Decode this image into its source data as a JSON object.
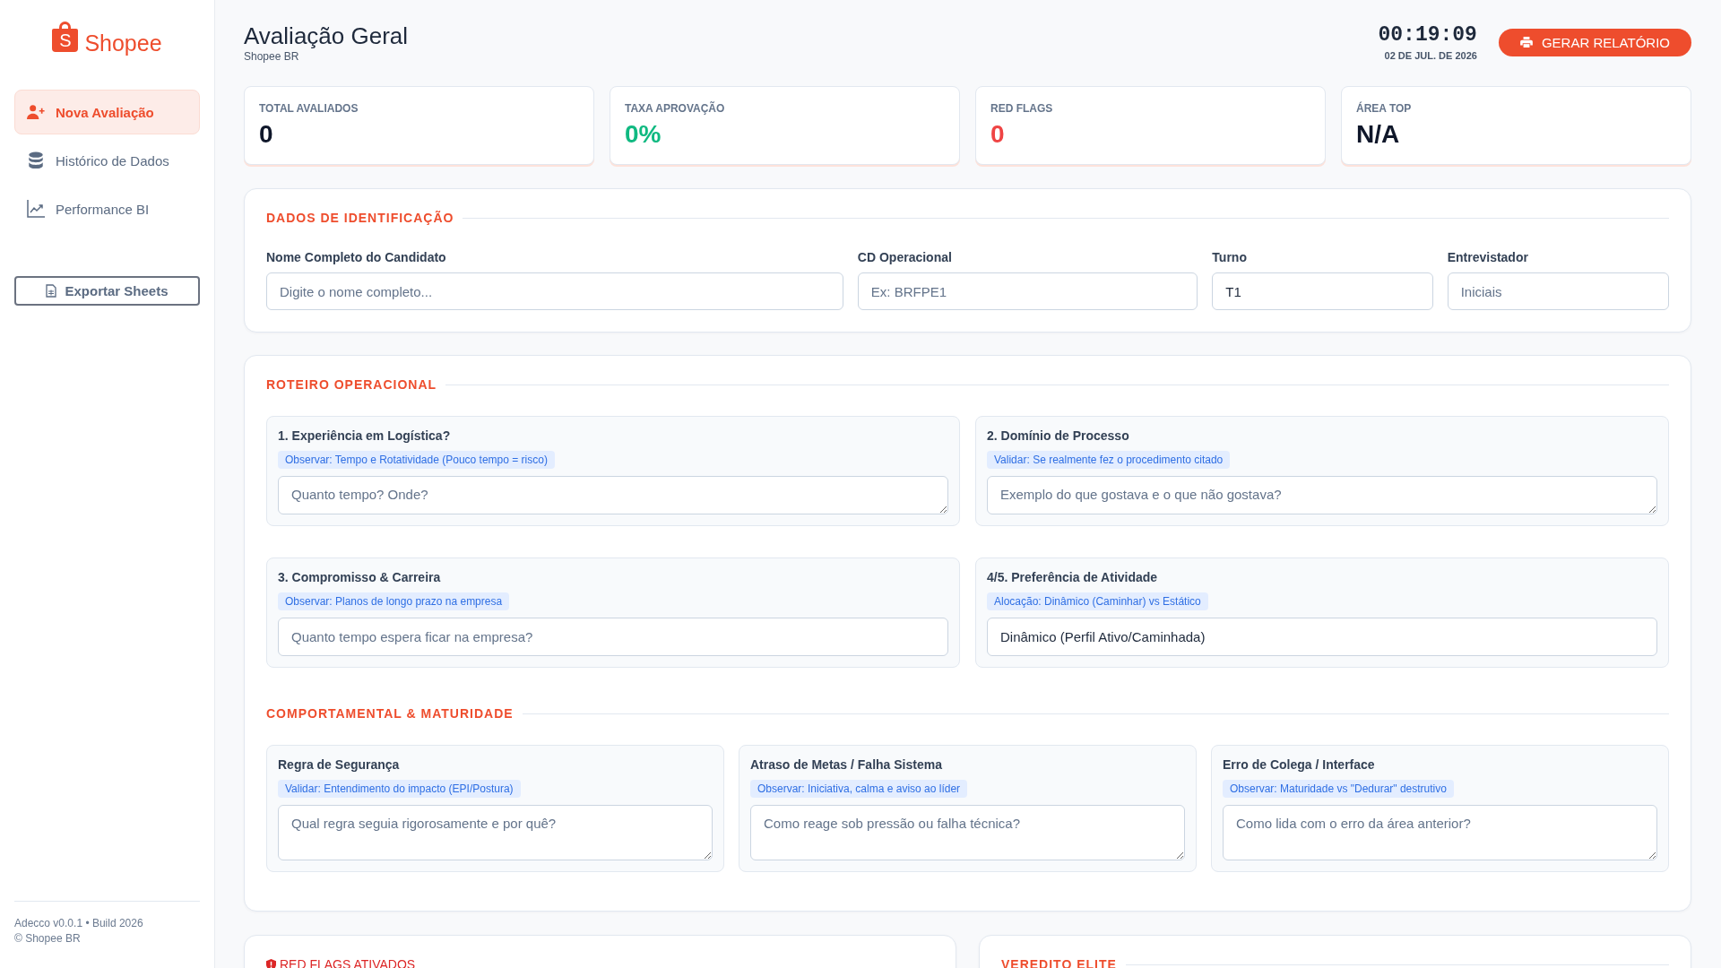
{
  "sidebar": {
    "logo": {
      "mark": "S",
      "name": "Shopee"
    },
    "nav_items": [
      {
        "label": "Nova Avaliação",
        "selected": true
      },
      {
        "label": "Histórico de Dados",
        "selected": false
      },
      {
        "label": "Performance BI",
        "selected": false
      }
    ],
    "export_button": "Exportar Sheets",
    "footer": [
      "Adecco v0.0.1 • Build 2026",
      "© Shopee BR"
    ]
  },
  "header": {
    "title": "Avaliação Geral",
    "subtitle": "Shopee BR",
    "clock": "00:19:09",
    "date": "02 DE JUL. DE 2026",
    "report_button": "GERAR RELATÓRIO"
  },
  "stats": [
    {
      "label": "TOTAL AVALIADOS",
      "value": "0",
      "color": "#0f172a"
    },
    {
      "label": "TAXA APROVAÇÃO",
      "value": "0%",
      "color": "#10b981"
    },
    {
      "label": "RED FLAGS",
      "value": "0",
      "color": "#ef4444"
    },
    {
      "label": "ÁREA TOP",
      "value": "N/A",
      "color": "#0f172a"
    }
  ],
  "identification": {
    "title": "DADOS DE IDENTIFICAÇÃO",
    "fields": [
      {
        "label": "Nome Completo do Candidato",
        "placeholder": "Digite o nome completo..."
      },
      {
        "label": "CD Operacional",
        "placeholder": "Ex: BRFPE1"
      },
      {
        "label": "Turno",
        "value": "T1"
      },
      {
        "label": "Entrevistador",
        "placeholder": "Iniciais"
      }
    ]
  },
  "script": {
    "sections": [
      {
        "title": "ROTEIRO OPERACIONAL",
        "questions": [
          {
            "title": "1. Experiência em Logística?",
            "hint": "Observar: Tempo e Rotatividade (Pouco tempo = risco)",
            "kind": "textarea",
            "placeholder": "Quanto tempo? Onde?"
          },
          {
            "title": "2. Domínio de Processo",
            "hint": "Validar: Se realmente fez o procedimento citado",
            "kind": "textarea",
            "placeholder": "Exemplo do que gostava e o que não gostava?"
          },
          {
            "title": "3. Compromisso & Carreira",
            "hint": "Observar: Planos de longo prazo na empresa",
            "kind": "input",
            "placeholder": "Quanto tempo espera ficar na empresa?"
          },
          {
            "title": "4/5. Preferência de Atividade",
            "hint": "Alocação: Dinâmico (Caminhar) vs Estático",
            "kind": "select",
            "value": "Dinâmico (Perfil Ativo/Caminhada)"
          }
        ]
      },
      {
        "title": "COMPORTAMENTAL & MATURIDADE",
        "questions": [
          {
            "title": "Regra de Segurança",
            "hint": "Validar: Entendimento do impacto (EPI/Postura)",
            "kind": "textarea",
            "placeholder": "Qual regra seguia rigorosamente e por quê?"
          },
          {
            "title": "Atraso de Metas / Falha Sistema",
            "hint": "Observar: Iniciativa, calma e aviso ao líder",
            "kind": "textarea",
            "placeholder": "Como reage sob pressão ou falha técnica?"
          },
          {
            "title": "Erro de Colega / Interface",
            "hint": "Observar: Maturidade vs \"Dedurar\" destrutivo",
            "kind": "textarea",
            "placeholder": "Como lida com o erro da área anterior?"
          }
        ]
      }
    ]
  },
  "summary": {
    "red_flags_title": "RED FLAGS ATIVADOS",
    "verdict_title": "VEREDITO ELITE"
  }
}
